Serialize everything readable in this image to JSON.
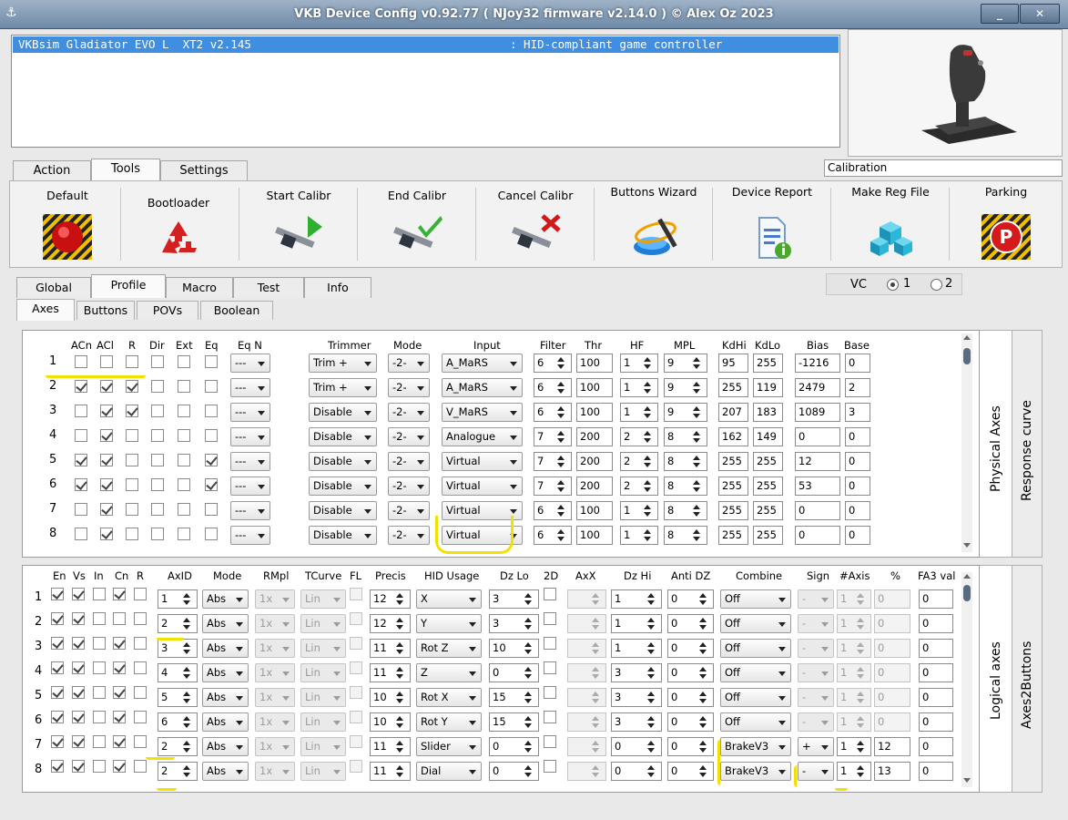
{
  "window": {
    "title": "VKB Device Config v0.92.77 ( NJoy32 firmware v2.14.0 ) © Alex Oz 2023",
    "minimize": "_",
    "close": "✕"
  },
  "device": {
    "name": "VKBsim Gladiator EVO L  XT2 v2.145",
    "type": ": HID-compliant game controller"
  },
  "calibration_label": "Calibration",
  "main_tabs": [
    "Action",
    "Tools",
    "Settings"
  ],
  "tools": [
    "Default",
    "Bootloader",
    "Start Calibr",
    "End Calibr",
    "Cancel Calibr",
    "Buttons Wizard",
    "Device Report",
    "Make Reg File",
    "Parking"
  ],
  "profile_tabs": [
    "Global",
    "Profile",
    "Macro",
    "Test",
    "Info"
  ],
  "vc": {
    "label": "VC",
    "options": [
      "1",
      "2"
    ],
    "selected": "1"
  },
  "sub_tabs": [
    "Axes",
    "Buttons",
    "POVs",
    "Boolean"
  ],
  "physical": {
    "side_tabs": [
      "Physical Axes",
      "Response curve"
    ],
    "headers": {
      "acn": "ACn",
      "acl": "ACl",
      "r": "R",
      "dir": "Dir",
      "ext": "Ext",
      "eq": "Eq",
      "eqn": "Eq N",
      "trimmer": "Trimmer",
      "mode": "Mode",
      "input": "Input",
      "filter": "Filter",
      "thr": "Thr",
      "hf": "HF",
      "mpl": "MPL",
      "kdhi": "KdHi",
      "kdlo": "KdLo",
      "bias": "Bias",
      "base": "Base"
    },
    "rows": [
      {
        "n": "1",
        "acn": false,
        "acl": false,
        "r": false,
        "dir": false,
        "ext": false,
        "eq": false,
        "eqn": "---",
        "trimmer": "Trim +",
        "mode": "-2-",
        "input": "A_MaRS",
        "filter": "6",
        "thr": "100",
        "hf": "1",
        "mpl": "9",
        "kdhi": "95",
        "kdlo": "255",
        "bias": "-1216",
        "base": "0"
      },
      {
        "n": "2",
        "acn": true,
        "acl": true,
        "r": true,
        "dir": false,
        "ext": false,
        "eq": false,
        "eqn": "---",
        "trimmer": "Trim +",
        "mode": "-2-",
        "input": "A_MaRS",
        "filter": "6",
        "thr": "100",
        "hf": "1",
        "mpl": "9",
        "kdhi": "255",
        "kdlo": "119",
        "bias": "2479",
        "base": "2"
      },
      {
        "n": "3",
        "acn": false,
        "acl": true,
        "r": true,
        "dir": false,
        "ext": false,
        "eq": false,
        "eqn": "---",
        "trimmer": "Disable",
        "mode": "-2-",
        "input": "V_MaRS",
        "filter": "6",
        "thr": "100",
        "hf": "1",
        "mpl": "9",
        "kdhi": "207",
        "kdlo": "183",
        "bias": "1089",
        "base": "3"
      },
      {
        "n": "4",
        "acn": false,
        "acl": true,
        "r": false,
        "dir": false,
        "ext": false,
        "eq": false,
        "eqn": "---",
        "trimmer": "Disable",
        "mode": "-2-",
        "input": "Analogue",
        "filter": "7",
        "thr": "200",
        "hf": "2",
        "mpl": "8",
        "kdhi": "162",
        "kdlo": "149",
        "bias": "0",
        "base": "0"
      },
      {
        "n": "5",
        "acn": true,
        "acl": true,
        "r": false,
        "dir": false,
        "ext": false,
        "eq": true,
        "eqn": "---",
        "trimmer": "Disable",
        "mode": "-2-",
        "input": "Virtual",
        "filter": "7",
        "thr": "200",
        "hf": "2",
        "mpl": "8",
        "kdhi": "255",
        "kdlo": "255",
        "bias": "12",
        "base": "0"
      },
      {
        "n": "6",
        "acn": true,
        "acl": true,
        "r": false,
        "dir": false,
        "ext": false,
        "eq": true,
        "eqn": "---",
        "trimmer": "Disable",
        "mode": "-2-",
        "input": "Virtual",
        "filter": "7",
        "thr": "200",
        "hf": "2",
        "mpl": "8",
        "kdhi": "255",
        "kdlo": "255",
        "bias": "53",
        "base": "0"
      },
      {
        "n": "7",
        "acn": false,
        "acl": true,
        "r": false,
        "dir": false,
        "ext": false,
        "eq": false,
        "eqn": "---",
        "trimmer": "Disable",
        "mode": "-2-",
        "input": "Virtual",
        "filter": "6",
        "thr": "100",
        "hf": "1",
        "mpl": "8",
        "kdhi": "255",
        "kdlo": "255",
        "bias": "0",
        "base": "0"
      },
      {
        "n": "8",
        "acn": false,
        "acl": true,
        "r": false,
        "dir": false,
        "ext": false,
        "eq": false,
        "eqn": "---",
        "trimmer": "Disable",
        "mode": "-2-",
        "input": "Virtual",
        "filter": "6",
        "thr": "100",
        "hf": "1",
        "mpl": "8",
        "kdhi": "255",
        "kdlo": "255",
        "bias": "0",
        "base": "0"
      }
    ]
  },
  "logical": {
    "side_tabs": [
      "Logical axes",
      "Axes2Buttons"
    ],
    "headers": {
      "en": "En",
      "vs": "Vs",
      "in": "In",
      "cn": "Cn",
      "r": "R",
      "axid": "AxID",
      "mode": "Mode",
      "rmpl": "RMpl",
      "tcurve": "TCurve",
      "fl": "FL",
      "precis": "Precis",
      "hid": "HID Usage",
      "dzlo": "Dz Lo",
      "twod": "2D",
      "axx": "AxX",
      "dzhi": "Dz Hi",
      "antidz": "Anti DZ",
      "combine": "Combine",
      "sign": "Sign",
      "naxis": "#Axis",
      "pct": "%",
      "fa3": "FA3 val"
    },
    "rows": [
      {
        "n": "1",
        "en": true,
        "vs": true,
        "in": false,
        "cn": true,
        "r": false,
        "axid": "1",
        "mode": "Abs",
        "rmpl": "1x",
        "tcurve": "Lin",
        "precis": "12",
        "hid": "X",
        "dzlo": "3",
        "dzhi": "1",
        "antidz": "0",
        "combine": "Off",
        "sign": "-",
        "naxis": "1",
        "pct": "0",
        "fa3": "0",
        "active": false
      },
      {
        "n": "2",
        "en": true,
        "vs": true,
        "in": false,
        "cn": false,
        "r": false,
        "axid": "2",
        "mode": "Abs",
        "rmpl": "1x",
        "tcurve": "Lin",
        "precis": "12",
        "hid": "Y",
        "dzlo": "3",
        "dzhi": "1",
        "antidz": "0",
        "combine": "Off",
        "sign": "-",
        "naxis": "1",
        "pct": "0",
        "fa3": "0",
        "active": false
      },
      {
        "n": "3",
        "en": true,
        "vs": true,
        "in": false,
        "cn": true,
        "r": false,
        "axid": "3",
        "mode": "Abs",
        "rmpl": "1x",
        "tcurve": "Lin",
        "precis": "11",
        "hid": "Rot Z",
        "dzlo": "10",
        "dzhi": "1",
        "antidz": "0",
        "combine": "Off",
        "sign": "-",
        "naxis": "1",
        "pct": "0",
        "fa3": "0",
        "active": false
      },
      {
        "n": "4",
        "en": true,
        "vs": true,
        "in": false,
        "cn": true,
        "r": false,
        "axid": "4",
        "mode": "Abs",
        "rmpl": "1x",
        "tcurve": "Lin",
        "precis": "11",
        "hid": "Z",
        "dzlo": "0",
        "dzhi": "3",
        "antidz": "0",
        "combine": "Off",
        "sign": "-",
        "naxis": "1",
        "pct": "0",
        "fa3": "0",
        "active": false
      },
      {
        "n": "5",
        "en": true,
        "vs": true,
        "in": false,
        "cn": true,
        "r": false,
        "axid": "5",
        "mode": "Abs",
        "rmpl": "1x",
        "tcurve": "Lin",
        "precis": "10",
        "hid": "Rot X",
        "dzlo": "15",
        "dzhi": "3",
        "antidz": "0",
        "combine": "Off",
        "sign": "-",
        "naxis": "1",
        "pct": "0",
        "fa3": "0",
        "active": false
      },
      {
        "n": "6",
        "en": true,
        "vs": true,
        "in": false,
        "cn": true,
        "r": false,
        "axid": "6",
        "mode": "Abs",
        "rmpl": "1x",
        "tcurve": "Lin",
        "precis": "10",
        "hid": "Rot Y",
        "dzlo": "15",
        "dzhi": "3",
        "antidz": "0",
        "combine": "Off",
        "sign": "-",
        "naxis": "1",
        "pct": "0",
        "fa3": "0",
        "active": false
      },
      {
        "n": "7",
        "en": true,
        "vs": true,
        "in": false,
        "cn": true,
        "r": false,
        "axid": "2",
        "mode": "Abs",
        "rmpl": "1x",
        "tcurve": "Lin",
        "precis": "11",
        "hid": "Slider",
        "dzlo": "0",
        "dzhi": "0",
        "antidz": "0",
        "combine": "BrakeV3",
        "sign": "+",
        "naxis": "1",
        "pct": "12",
        "fa3": "0",
        "active": true
      },
      {
        "n": "8",
        "en": true,
        "vs": true,
        "in": false,
        "cn": true,
        "r": false,
        "axid": "2",
        "mode": "Abs",
        "rmpl": "1x",
        "tcurve": "Lin",
        "precis": "11",
        "hid": "Dial",
        "dzlo": "0",
        "dzhi": "0",
        "antidz": "0",
        "combine": "BrakeV3",
        "sign": "-",
        "naxis": "1",
        "pct": "13",
        "fa3": "0",
        "active": true
      }
    ]
  },
  "colors": {
    "selection": "#3f8ee0",
    "highlight_marker": "#f4e000",
    "title_bar": "#7b95b2"
  }
}
